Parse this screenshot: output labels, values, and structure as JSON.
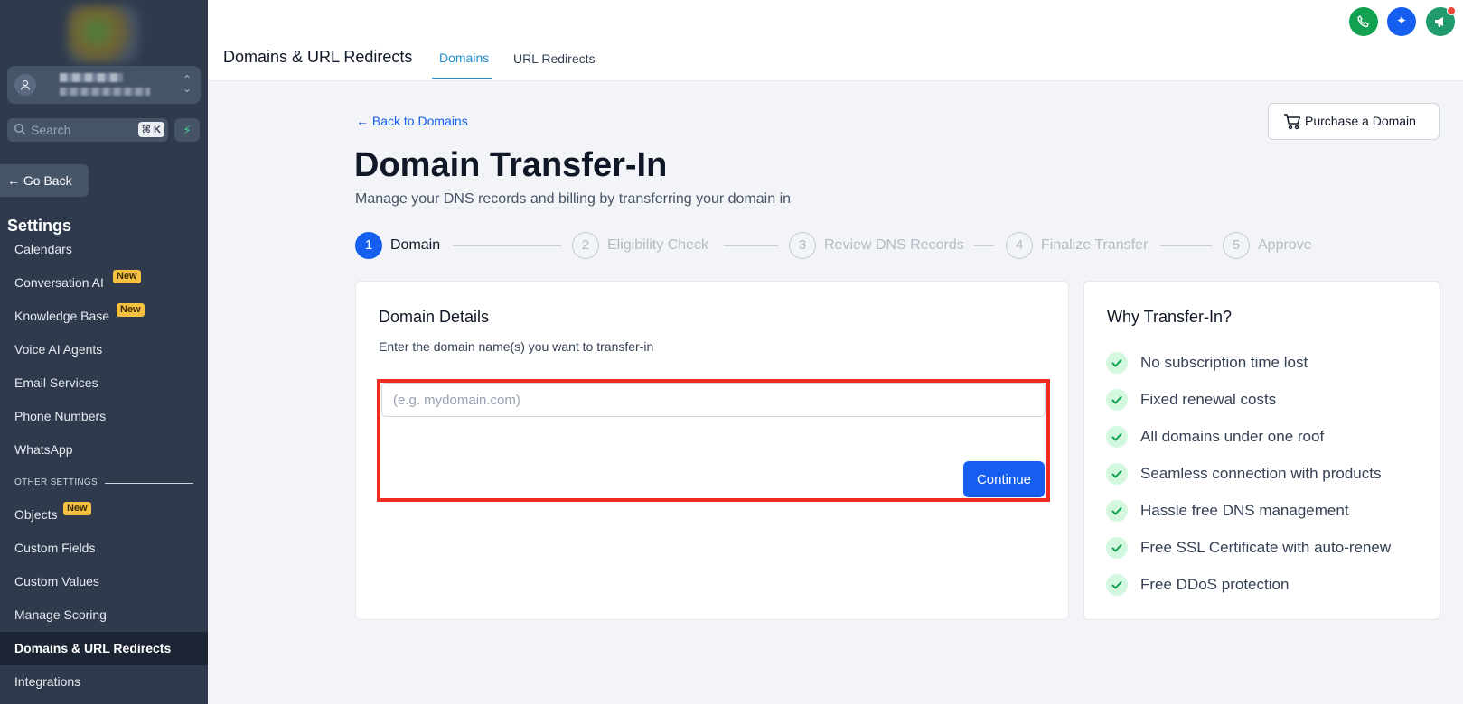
{
  "sidebar": {
    "search_placeholder": "Search",
    "search_shortcut": "⌘ K",
    "go_back": "Go Back",
    "settings_title": "Settings",
    "items": [
      {
        "label": "Calendars"
      },
      {
        "label": "Conversation AI",
        "badge": "New"
      },
      {
        "label": "Knowledge Base",
        "badge": "New"
      },
      {
        "label": "Voice AI Agents"
      },
      {
        "label": "Email Services"
      },
      {
        "label": "Phone Numbers"
      },
      {
        "label": "WhatsApp"
      }
    ],
    "other_settings_label": "OTHER SETTINGS",
    "other_items": [
      {
        "label": "Objects",
        "badge": "New"
      },
      {
        "label": "Custom Fields"
      },
      {
        "label": "Custom Values"
      },
      {
        "label": "Manage Scoring"
      },
      {
        "label": "Domains & URL Redirects"
      },
      {
        "label": "Integrations"
      }
    ],
    "active_item": "Domains & URL Redirects"
  },
  "topbar": {
    "title": "Domains & URL Redirects",
    "tabs": [
      {
        "label": "Domains",
        "active": true
      },
      {
        "label": "URL Redirects",
        "active": false
      }
    ],
    "icons": [
      {
        "name": "phone-icon",
        "color": "#12a150"
      },
      {
        "name": "sparkle-icon",
        "color": "#155eef"
      },
      {
        "name": "megaphone-icon",
        "color": "#1f9b6e"
      }
    ]
  },
  "main": {
    "back_link": "Back to Domains",
    "purchase_button": "Purchase a Domain",
    "title": "Domain Transfer-In",
    "subtitle": "Manage your DNS records and billing by transferring your domain in",
    "steps": [
      {
        "number": "1",
        "label": "Domain",
        "active": true
      },
      {
        "number": "2",
        "label": "Eligibility Check",
        "active": false
      },
      {
        "number": "3",
        "label": "Review DNS Records",
        "active": false
      },
      {
        "number": "4",
        "label": "Finalize Transfer",
        "active": false
      },
      {
        "number": "5",
        "label": "Approve",
        "active": false
      }
    ],
    "details_card": {
      "title": "Domain Details",
      "description": "Enter the domain name(s) you want to transfer-in",
      "input_placeholder": "(e.g. mydomain.com)",
      "input_value": "",
      "continue_button": "Continue"
    },
    "why_card": {
      "title": "Why Transfer-In?",
      "benefits": [
        "No subscription time lost",
        "Fixed renewal costs",
        "All domains under one roof",
        "Seamless connection with products",
        "Hassle free DNS management",
        "Free SSL Certificate with auto-renew",
        "Free DDoS protection"
      ]
    }
  },
  "colors": {
    "sidebar_bg": "#2f3a4c",
    "primary": "#155eef",
    "tab_active": "#1e8fd0",
    "badge": "#f4c141",
    "highlight": "#ef2b24",
    "check_bg": "#d3f8df",
    "check": "#12a150"
  }
}
